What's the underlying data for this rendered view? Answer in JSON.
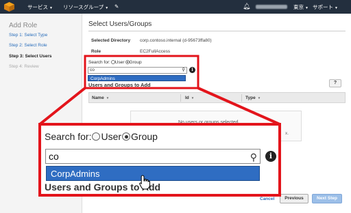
{
  "topbar": {
    "services_label": "サービス",
    "resource_groups_label": "リソースグループ",
    "region_label": "東京",
    "support_label": "サポート"
  },
  "sidebar": {
    "title": "Add Role",
    "steps": [
      {
        "label": "Step 1: Select Type",
        "state": "link"
      },
      {
        "label": "Step 2: Select Role",
        "state": "link"
      },
      {
        "label": "Step 3: Select Users",
        "state": "current"
      },
      {
        "label": "Step 4: Review",
        "state": "disabled"
      }
    ]
  },
  "main": {
    "title": "Select Users/Groups",
    "selected_directory_label": "Selected Directory",
    "selected_directory_value": "corp.contoso.internal (d-95673ffa80)",
    "role_label": "Role",
    "role_value": "EC2FullAccess",
    "search_for_label": "Search for:",
    "user_option": "User",
    "group_option": "Group",
    "search_value": "co",
    "dropdown_item": "CorpAdmins",
    "section_heading": "Users and Groups to Add",
    "help_label": "?",
    "columns": [
      "Name",
      "Id",
      "Type"
    ],
    "empty_message": "No users or groups selected",
    "empty_hint": "x.",
    "cancel_label": "Cancel",
    "previous_label": "Previous",
    "next_label": "Next Step"
  },
  "colors": {
    "highlight": "#e3141b",
    "topbar": "#232f3e",
    "dropdown": "#2f6dc2",
    "link": "#2a6ebb"
  }
}
